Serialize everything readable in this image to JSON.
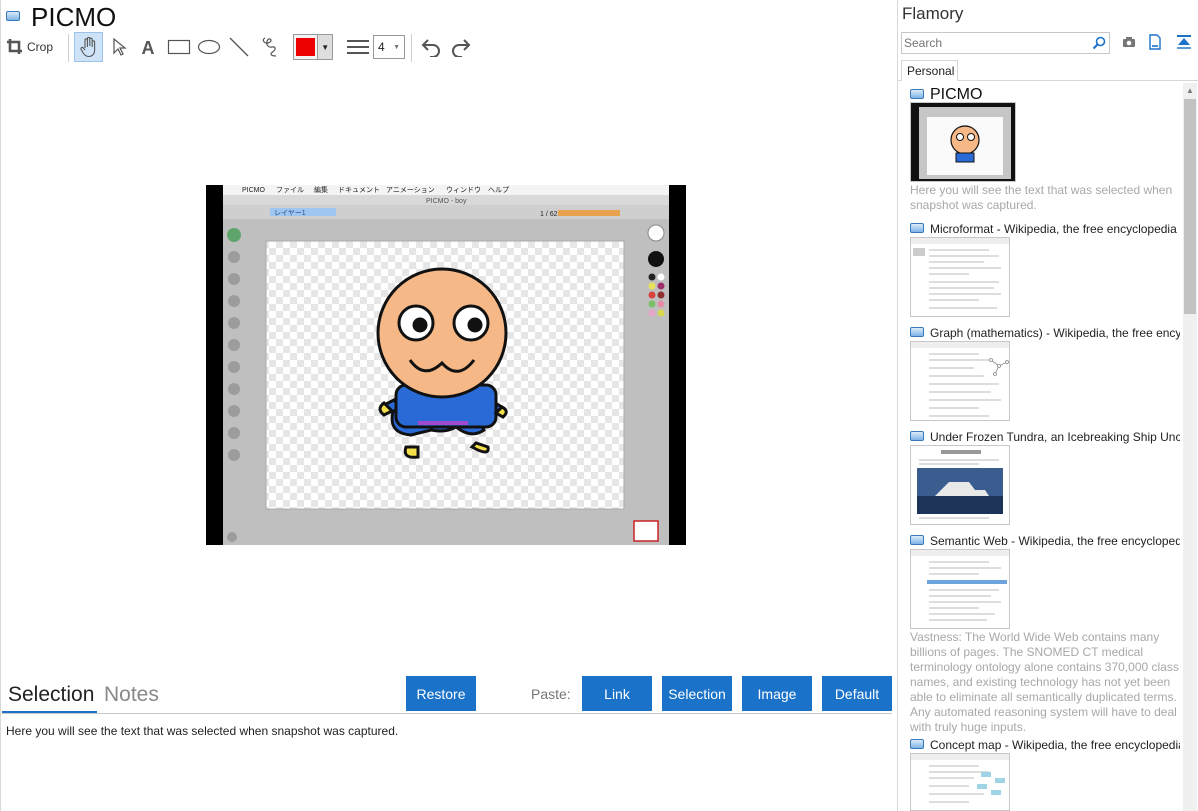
{
  "app": {
    "title": "PICMO"
  },
  "toolbar": {
    "crop_label": "Crop",
    "color": "#ee0000",
    "line_width": "4",
    "tools": [
      "pan-tool",
      "select-tool",
      "text-tool",
      "rectangle-tool",
      "ellipse-tool",
      "line-tool",
      "freehand-tool"
    ]
  },
  "snapshot": {
    "menu": [
      "PICMO",
      "ファイル",
      "編集",
      "ドキュメント",
      "アニメーション",
      "ウィンドウ",
      "ヘルプ"
    ],
    "window_title": "PICMO - boy",
    "layer_label": "レイヤー1",
    "frame_counter": "1 / 62"
  },
  "bottom": {
    "tabs": [
      "Selection",
      "Notes"
    ],
    "restore": "Restore",
    "paste_label": "Paste:",
    "paste_buttons": [
      "Link",
      "Selection",
      "Image",
      "Default"
    ],
    "selection_text": "Here you will see the text that was selected when snapshot was captured."
  },
  "sidebar": {
    "title": "Flamory",
    "search_placeholder": "Search",
    "tab": "Personal",
    "items": [
      {
        "title": "PICMO",
        "caption": "Here you will see the text that was selected when snapshot was captured."
      },
      {
        "title": "Microformat - Wikipedia, the free encyclopedia"
      },
      {
        "title": "Graph (mathematics) - Wikipedia, the free encyclopedia"
      },
      {
        "title": "Under Frozen Tundra, an Icebreaking Ship Uncovers"
      },
      {
        "title": "Semantic Web - Wikipedia, the free encyclopedia",
        "caption": "Vastness: The World Wide Web contains many billions of pages. The SNOMED CT medical terminology ontology alone contains 370,000 class names, and existing technology has not yet been able to eliminate all semantically duplicated terms. Any automated reasoning system will have to deal with truly huge inputs."
      },
      {
        "title": "Concept map - Wikipedia, the free encyclopedia"
      }
    ]
  }
}
